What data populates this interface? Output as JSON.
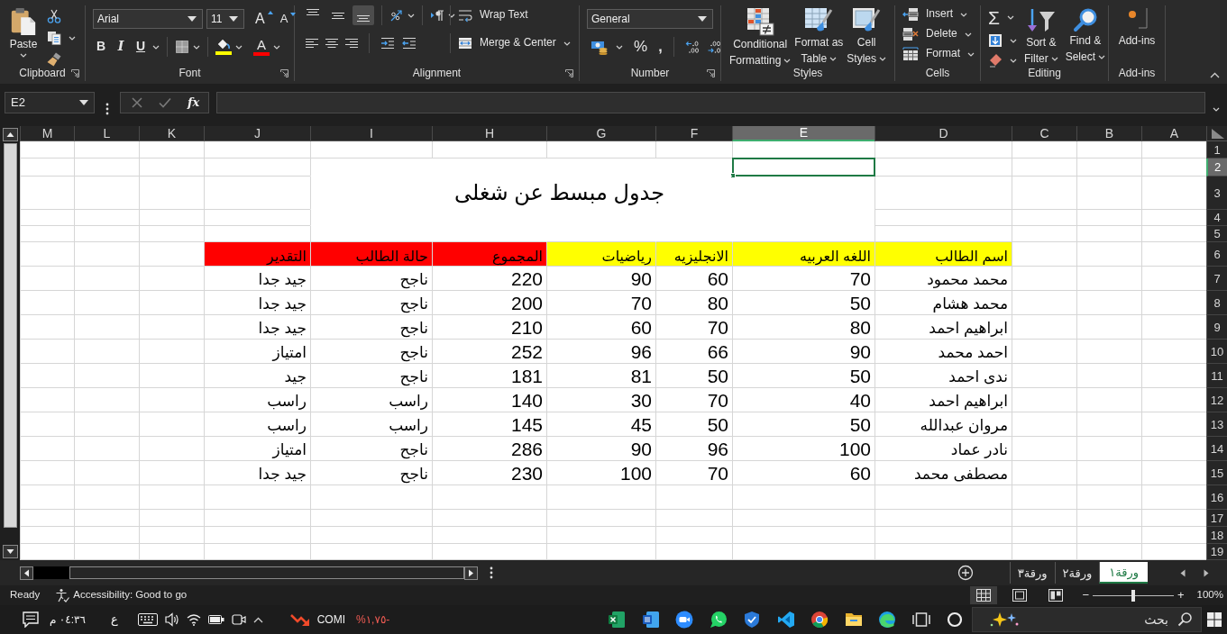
{
  "ribbon": {
    "clipboard": {
      "paste": "Paste",
      "label": "Clipboard"
    },
    "font": {
      "font_name": "Arial",
      "font_size": "11",
      "grow": "A",
      "shrink": "A",
      "bold": "B",
      "italic": "I",
      "underline": "U",
      "font_color": "A",
      "label": "Font"
    },
    "alignment": {
      "vertical": [
        {
          "selected": false
        },
        {
          "selected": false
        },
        {
          "selected": true
        }
      ],
      "wrap_text": "Wrap Text",
      "merge_center": "Merge & Center",
      "label": "Alignment"
    },
    "number": {
      "format": "General",
      "percent": "%",
      "comma": ",",
      "label": "Number"
    },
    "styles": {
      "conditional_formatting": [
        "Conditional",
        "Formatting"
      ],
      "format_as_table": [
        "Format as",
        "Table"
      ],
      "cell_styles": [
        "Cell",
        "Styles"
      ],
      "label": "Styles"
    },
    "cells": {
      "buttons": [
        "Insert",
        "Delete",
        "Format"
      ],
      "label": "Cells"
    },
    "editing": {
      "autosum": "Σ",
      "sort_filter": [
        "Sort &",
        "Filter"
      ],
      "find_select": [
        "Find &",
        "Select"
      ],
      "label": "Editing"
    },
    "addins": {
      "button": "Add-ins",
      "label": "Add-ins"
    }
  },
  "formula_bar": {
    "name_box": "E2",
    "function": "fx"
  },
  "sheet": {
    "columns": [
      {
        "label": "A",
        "selected": false
      },
      {
        "label": "B",
        "selected": false
      },
      {
        "label": "C",
        "selected": false
      },
      {
        "label": "D",
        "selected": false
      },
      {
        "label": "E",
        "selected": true
      },
      {
        "label": "F",
        "selected": false
      },
      {
        "label": "G",
        "selected": false
      },
      {
        "label": "H",
        "selected": false
      },
      {
        "label": "I",
        "selected": false
      },
      {
        "label": "J",
        "selected": false
      },
      {
        "label": "K",
        "selected": false
      },
      {
        "label": "L",
        "selected": false
      },
      {
        "label": "M",
        "selected": false
      }
    ],
    "rows": [
      {
        "label": "1",
        "selected": false
      },
      {
        "label": "2",
        "selected": true
      },
      {
        "label": "3",
        "selected": false
      },
      {
        "label": "4",
        "selected": false
      },
      {
        "label": "5",
        "selected": false
      },
      {
        "label": "6",
        "selected": false
      },
      {
        "label": "7",
        "selected": false
      },
      {
        "label": "8",
        "selected": false
      },
      {
        "label": "9",
        "selected": false
      },
      {
        "label": "10",
        "selected": false
      },
      {
        "label": "11",
        "selected": false
      },
      {
        "label": "12",
        "selected": false
      },
      {
        "label": "13",
        "selected": false
      },
      {
        "label": "14",
        "selected": false
      },
      {
        "label": "15",
        "selected": false
      },
      {
        "label": "16",
        "selected": false
      },
      {
        "label": "17",
        "selected": false
      },
      {
        "label": "18",
        "selected": false
      },
      {
        "label": "19",
        "selected": false
      }
    ],
    "title": "جدول مبسط عن شغلى",
    "table": {
      "header": [
        {
          "text": "اسم الطالب",
          "color": "#ffff00"
        },
        {
          "text": "اللغه العربيه",
          "color": "#ffff00"
        },
        {
          "text": "الانجليزيه",
          "color": "#ffff00"
        },
        {
          "text": "رياضيات",
          "color": "#ffff00"
        },
        {
          "text": "المجموع",
          "color": "#ff0000"
        },
        {
          "text": "حالة الطالب",
          "color": "#ff0000"
        },
        {
          "text": "التقدير",
          "color": "#ff0000"
        }
      ],
      "rows": [
        [
          "محمد محمود",
          "70",
          "60",
          "90",
          "220",
          "ناجح",
          "جيد جدا"
        ],
        [
          "محمد هشام",
          "50",
          "80",
          "70",
          "200",
          "ناجح",
          "جيد جدا"
        ],
        [
          "ابراهيم احمد",
          "80",
          "70",
          "60",
          "210",
          "ناجح",
          "جيد جدا"
        ],
        [
          "احمد محمد",
          "90",
          "66",
          "96",
          "252",
          "ناجح",
          "امتياز"
        ],
        [
          "ندى احمد",
          "50",
          "50",
          "81",
          "181",
          "ناجح",
          "جيد"
        ],
        [
          "ابراهيم احمد",
          "40",
          "70",
          "30",
          "140",
          "راسب",
          "راسب"
        ],
        [
          "مروان عبدالله",
          "50",
          "50",
          "45",
          "145",
          "راسب",
          "راسب"
        ],
        [
          "نادر عماد",
          "100",
          "96",
          "90",
          "286",
          "ناجح",
          "امتياز"
        ],
        [
          "مصطفى محمد",
          "60",
          "70",
          "100",
          "230",
          "ناجح",
          "جيد جدا"
        ]
      ]
    }
  },
  "sheet_tabs": [
    {
      "label": "ورقة١",
      "selected": true
    },
    {
      "label": "ورقة٢",
      "selected": false
    },
    {
      "label": "ورقة٣",
      "selected": false
    }
  ],
  "status_bar": {
    "status": "Ready",
    "accessibility": "Accessibility: Good to go",
    "views": [
      {
        "selected": true
      },
      {
        "selected": false
      },
      {
        "selected": false
      }
    ],
    "zoom": {
      "minus": "−",
      "plus": "+",
      "level": 0.5,
      "reading": "100%"
    }
  },
  "taskbar": {
    "time": "٠٤:٣٦ م",
    "language": "ع",
    "stock": {
      "symbol": "COMI",
      "change": "%١,٧٥-"
    },
    "search": {
      "placeholder": "بحث"
    }
  }
}
